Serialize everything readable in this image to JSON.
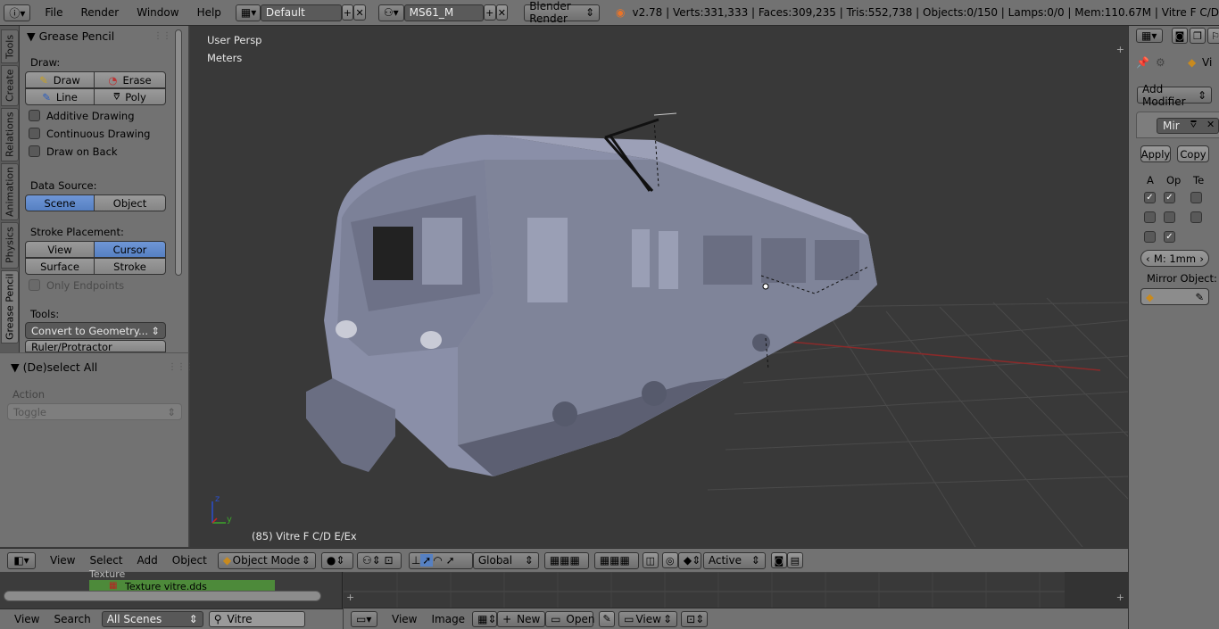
{
  "topbar": {
    "menus": [
      "File",
      "Render",
      "Window",
      "Help"
    ],
    "screen_layout": "Default",
    "scene_name": "MS61_M",
    "render_engine": "Blender Render",
    "stats": "v2.78 | Verts:331,333 | Faces:309,235 | Tris:552,738 | Objects:0/150 | Lamps:0/0 | Mem:110.67M | Vitre F C/D"
  },
  "tabs": [
    "Tools",
    "Create",
    "Relations",
    "Animation",
    "Physics",
    "Grease Pencil"
  ],
  "toolpanel": {
    "title": "Grease Pencil",
    "draw_label": "Draw:",
    "draw_btn": "Draw",
    "erase_btn": "Erase",
    "line_btn": "Line",
    "poly_btn": "Poly",
    "additive": "Additive Drawing",
    "continuous": "Continuous Drawing",
    "draw_back": "Draw on Back",
    "data_source_label": "Data Source:",
    "scene_btn": "Scene",
    "object_btn": "Object",
    "stroke_label": "Stroke Placement:",
    "view_btn": "View",
    "cursor_btn": "Cursor",
    "surface_btn": "Surface",
    "stroke_btn": "Stroke",
    "only_endpoints": "Only Endpoints",
    "tools_label": "Tools:",
    "convert_btn": "Convert to Geometry...",
    "ruler_btn": "Ruler/Protractor"
  },
  "ops": {
    "title": "(De)select All",
    "action_label": "Action",
    "action_value": "Toggle"
  },
  "viewport": {
    "view_name": "User Persp",
    "units": "Meters",
    "object_info": "(85) Vitre F C/D  E/Ex"
  },
  "props": {
    "vi_label": "Vi",
    "add_modifier": "Add Modifier",
    "mir_label": "Mir",
    "apply_btn": "Apply",
    "copy_btn": "Copy",
    "col_a": "A",
    "col_op": "Op",
    "col_te": "Te",
    "merge_value": "M: 1mm",
    "mirror_object": "Mirror Object:"
  },
  "vheader": {
    "view": "View",
    "select": "Select",
    "add": "Add",
    "object": "Object",
    "mode": "Object Mode",
    "orientation": "Global",
    "active": "Active"
  },
  "outliner": {
    "row1": "Texture",
    "row2": "Texture vitre.dds",
    "view": "View",
    "search": "Search",
    "scenes": "All Scenes",
    "filter_value": "Vitre"
  },
  "imgeditor": {
    "view": "View",
    "image": "Image",
    "new_btn": "New",
    "open_btn": "Open",
    "view2": "View"
  },
  "colors": {
    "panel": "#727272",
    "viewport": "#393939",
    "selected": "#5680c2",
    "train": "#8a8fa8"
  }
}
